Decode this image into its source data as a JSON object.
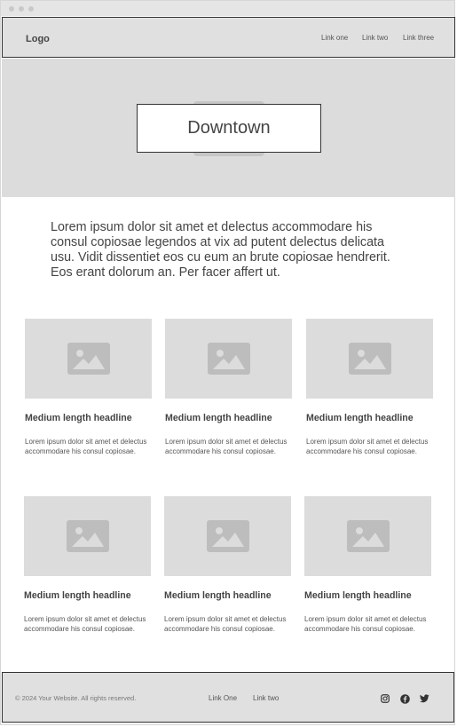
{
  "nav": {
    "logo": "Logo",
    "links": [
      "Link one",
      "Link two",
      "Link three"
    ]
  },
  "hero": {
    "title": "Downtown"
  },
  "intro": {
    "text": "Lorem ipsum dolor sit amet et delectus accommodare his consul copiosae legendos at vix ad putent delectus delicata usu. Vidit dissentiet eos cu eum an brute copiosae hendrerit. Eos erant dolorum an. Per facer affert ut."
  },
  "cards": [
    {
      "headline": "Medium length headline",
      "body": "Lorem ipsum dolor sit amet et delectus accommodare his consul copiosae.",
      "image_icon": "image-placeholder-icon"
    },
    {
      "headline": "Medium length headline",
      "body": "Lorem ipsum dolor sit amet et delectus accommodare his consul copiosae.",
      "image_icon": "image-placeholder-icon"
    },
    {
      "headline": "Medium length headline",
      "body": "Lorem ipsum dolor sit amet et delectus accommodare his consul copiosae.",
      "image_icon": "image-placeholder-icon"
    },
    {
      "headline": "Medium length headline",
      "body": "Lorem ipsum dolor sit amet et delectus accommodare his consul copiosae.",
      "image_icon": "image-placeholder-icon"
    },
    {
      "headline": "Medium length headline",
      "body": "Lorem ipsum dolor sit amet et delectus accommodare his consul copiosae.",
      "image_icon": "image-placeholder-icon"
    },
    {
      "headline": "Medium length headline",
      "body": "Lorem ipsum dolor sit amet et delectus accommodare his consul copiosae.",
      "image_icon": "image-placeholder-icon"
    }
  ],
  "footer": {
    "copyright": "© 2024 Your Website. All rights reserved.",
    "links": [
      "Link One",
      "Link two"
    ],
    "social_icons": [
      "instagram-icon",
      "facebook-icon",
      "twitter-icon"
    ]
  },
  "colors": {
    "placeholder_fill": "#dcdcdc",
    "icon_fill": "#bdbdbd",
    "text": "#444444",
    "border": "#333333"
  }
}
